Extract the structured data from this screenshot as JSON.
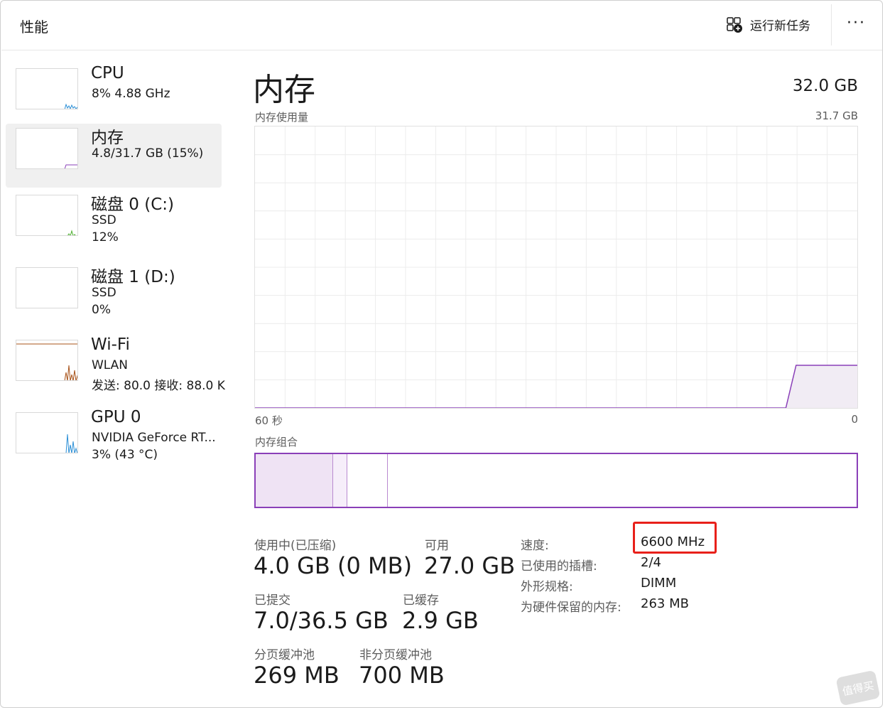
{
  "header": {
    "title": "性能",
    "run_task_label": "运行新任务",
    "more_icon": "more-horizontal-icon",
    "more_glyph": "···"
  },
  "sidebar": {
    "items": [
      {
        "title": "CPU",
        "lines": [
          "8%  4.88 GHz"
        ],
        "thumb_color": "#2b8fd6"
      },
      {
        "title": "内存",
        "lines": [
          "4.8/31.7 GB (15%)"
        ],
        "thumb_color": "#8a3fb8"
      },
      {
        "title": "磁盘 0 (C:)",
        "lines": [
          "SSD",
          "12%"
        ],
        "thumb_color": "#4caf2e"
      },
      {
        "title": "磁盘 1 (D:)",
        "lines": [
          "SSD",
          "0%"
        ],
        "thumb_color": "#4caf2e"
      },
      {
        "title": "Wi-Fi",
        "lines": [
          "WLAN",
          "发送: 80.0  接收: 88.0 K"
        ],
        "thumb_color": "#a8531a"
      },
      {
        "title": "GPU 0",
        "lines": [
          "NVIDIA GeForce RT...",
          "3%  (43 °C)"
        ],
        "thumb_color": "#2b8fd6"
      }
    ]
  },
  "main": {
    "title": "内存",
    "total": "32.0 GB",
    "usage_label": "内存使用量",
    "usage_max": "31.7 GB",
    "time_left": "60 秒",
    "time_right": "0",
    "composition_label": "内存组合",
    "accent": "#8a3fb8"
  },
  "stats": {
    "in_use_label": "使用中(已压缩)",
    "in_use_value": "4.0 GB (0 MB)",
    "available_label": "可用",
    "available_value": "27.0 GB",
    "committed_label": "已提交",
    "committed_value": "7.0/36.5 GB",
    "cached_label": "已缓存",
    "cached_value": "2.9 GB",
    "paged_label": "分页缓冲池",
    "paged_value": "269 MB",
    "nonpaged_label": "非分页缓冲池",
    "nonpaged_value": "700 MB"
  },
  "details": {
    "speed_label": "速度:",
    "speed_value": "6600 MHz",
    "slots_label": "已使用的插槽:",
    "slots_value": "2/4",
    "form_label": "外形规格:",
    "form_value": "DIMM",
    "reserved_label": "为硬件保留的内存:",
    "reserved_value": "263 MB"
  },
  "watermark": "值得买",
  "chart_data": {
    "type": "area",
    "title": "内存使用量",
    "xlabel": "",
    "ylabel": "",
    "x_range_label": [
      "60 秒",
      "0"
    ],
    "ylim": [
      0,
      31.7
    ],
    "series": [
      {
        "values": [
          0,
          0,
          0,
          0,
          0,
          0,
          0,
          0,
          0,
          0,
          0,
          0,
          0,
          0,
          0,
          0,
          0,
          0,
          0,
          0,
          0,
          0,
          0,
          0,
          0,
          0,
          0,
          0,
          0,
          0,
          0,
          0,
          0,
          0,
          0,
          0,
          0,
          0,
          0,
          0,
          0,
          0,
          0,
          0,
          0,
          0,
          0,
          0,
          0,
          0,
          0,
          0,
          0,
          4.8,
          4.8,
          4.8,
          4.8,
          4.8,
          4.8,
          4.8
        ]
      }
    ]
  }
}
